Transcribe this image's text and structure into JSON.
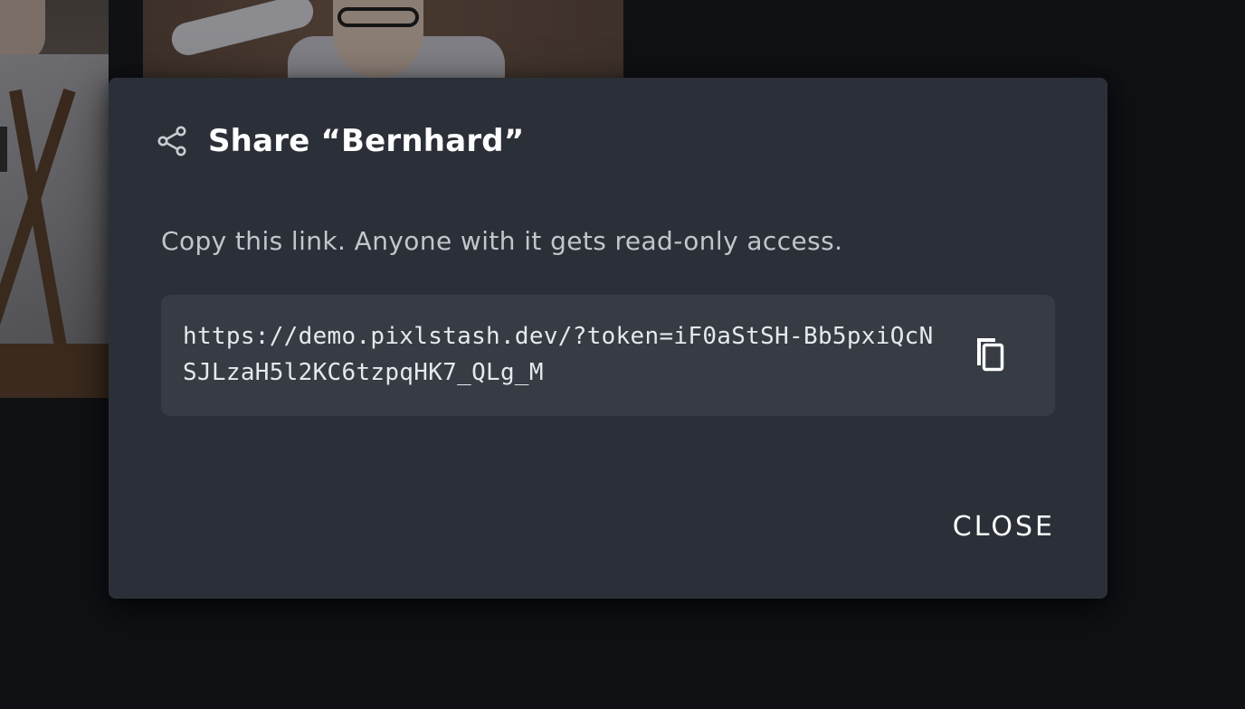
{
  "dialog": {
    "title": "Share “Bernhard”",
    "description": "Copy this link. Anyone with it gets read-only access.",
    "share_link": "https://demo.pixlstash.dev/?token=iF0aStSH-Bb5pxiQcNSJLzaH5l2KC6tzpqHK7_QLg_M",
    "close_label": "CLOSE",
    "icons": {
      "header": "share-icon",
      "copy": "copy-icon"
    }
  },
  "colors": {
    "dialog_background": "#2b3038",
    "link_box_background": "#363b44",
    "page_background": "#0f1115",
    "text_primary": "#ffffff",
    "text_secondary": "#c2c6cc"
  }
}
